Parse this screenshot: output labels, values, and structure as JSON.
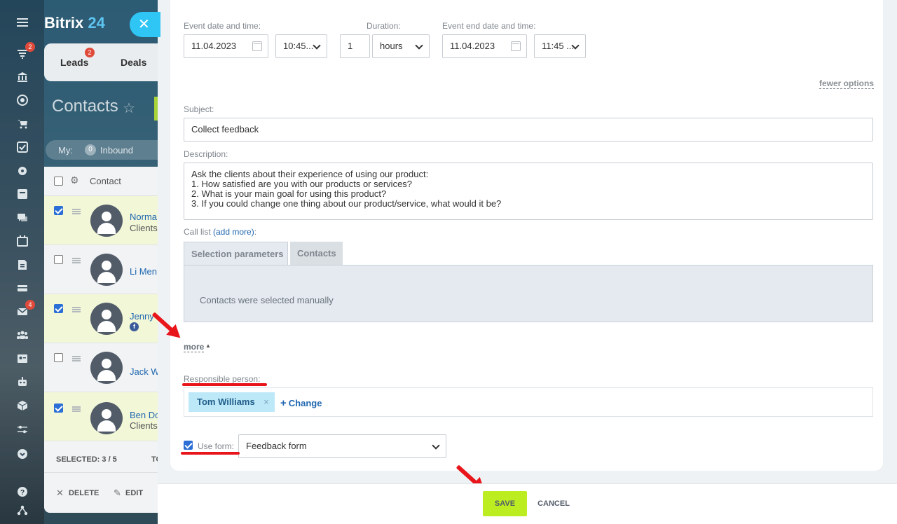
{
  "rail": {
    "items": [
      {
        "icon": "menu-icon"
      },
      {
        "icon": "funnel-icon",
        "badge": "2"
      },
      {
        "icon": "bank-icon"
      },
      {
        "icon": "target-icon"
      },
      {
        "icon": "cart-icon"
      },
      {
        "icon": "tasks-icon"
      },
      {
        "icon": "puzzle-icon"
      },
      {
        "icon": "feed-icon"
      },
      {
        "icon": "chat-icon"
      },
      {
        "icon": "calendar-icon"
      },
      {
        "icon": "document-icon"
      },
      {
        "icon": "inbox-icon"
      },
      {
        "icon": "mail-icon",
        "badge": "4"
      },
      {
        "icon": "group-icon"
      },
      {
        "icon": "contact-card-icon"
      },
      {
        "icon": "robot-icon"
      },
      {
        "icon": "cube-icon"
      },
      {
        "icon": "sliders-icon"
      },
      {
        "icon": "chevron-circle-icon"
      },
      {
        "icon": "help-icon"
      },
      {
        "icon": "sitemap-icon"
      }
    ]
  },
  "background": {
    "logo_part1": "Bitrix",
    "logo_part2": "24",
    "tab_leads": "Leads",
    "tab_leads_badge": "2",
    "tab_deals": "Deals",
    "page_title": "Contacts",
    "filter_my": "My:",
    "filter_count": "0",
    "filter_inbound": "Inbound",
    "grid_header": "Contact",
    "rows": [
      {
        "name": "Norma",
        "sub": "Clients",
        "selected": true
      },
      {
        "name": "Li Men",
        "sub": "",
        "selected": false
      },
      {
        "name": "Jenny",
        "sub": "",
        "selected": true,
        "fb": true
      },
      {
        "name": "Jack W",
        "sub": "",
        "selected": false
      },
      {
        "name": "Ben Do",
        "sub": "Clients",
        "selected": true
      }
    ],
    "selected_count": "SELECTED: 3 / 5",
    "footer_extra": "TO",
    "delete_label": "DELETE",
    "edit_label": "EDIT"
  },
  "form": {
    "event_date_label": "Event date and time:",
    "event_date_value": "11.04.2023",
    "event_time_value": "10:45...",
    "duration_label": "Duration:",
    "duration_value": "1",
    "duration_unit": "hours",
    "event_end_label": "Event end date and time:",
    "event_end_date_value": "11.04.2023",
    "event_end_time_value": "11:45 ...",
    "fewer_options": "fewer options",
    "subject_label": "Subject:",
    "subject_value": "Collect feedback",
    "description_label": "Description:",
    "description_lines": [
      "Ask the clients about their experience of using our product:",
      "1. How satisfied are you with our products or services?",
      "2. What is your main goal for using this product?",
      "3. If you could change one thing about our product/service, what would it be?"
    ],
    "call_list_label": "Call list",
    "add_more": "(add more)",
    "call_list_colon": ":",
    "tab_selection": "Selection parameters",
    "tab_contacts": "Contacts",
    "tab_panel_text": "Contacts were selected manually",
    "more_link": "more",
    "responsible_label": "Responsible person:",
    "responsible_name": "Tom Williams",
    "change_link": "Change",
    "use_form_label": "Use form:",
    "use_form_value": "Feedback form"
  },
  "footer": {
    "save": "SAVE",
    "cancel": "CANCEL"
  },
  "colors": {
    "accent_blue": "#2fc6f6",
    "save_green": "#bbed21",
    "annotation_red": "#e8151b",
    "link_blue": "#2067b0"
  }
}
